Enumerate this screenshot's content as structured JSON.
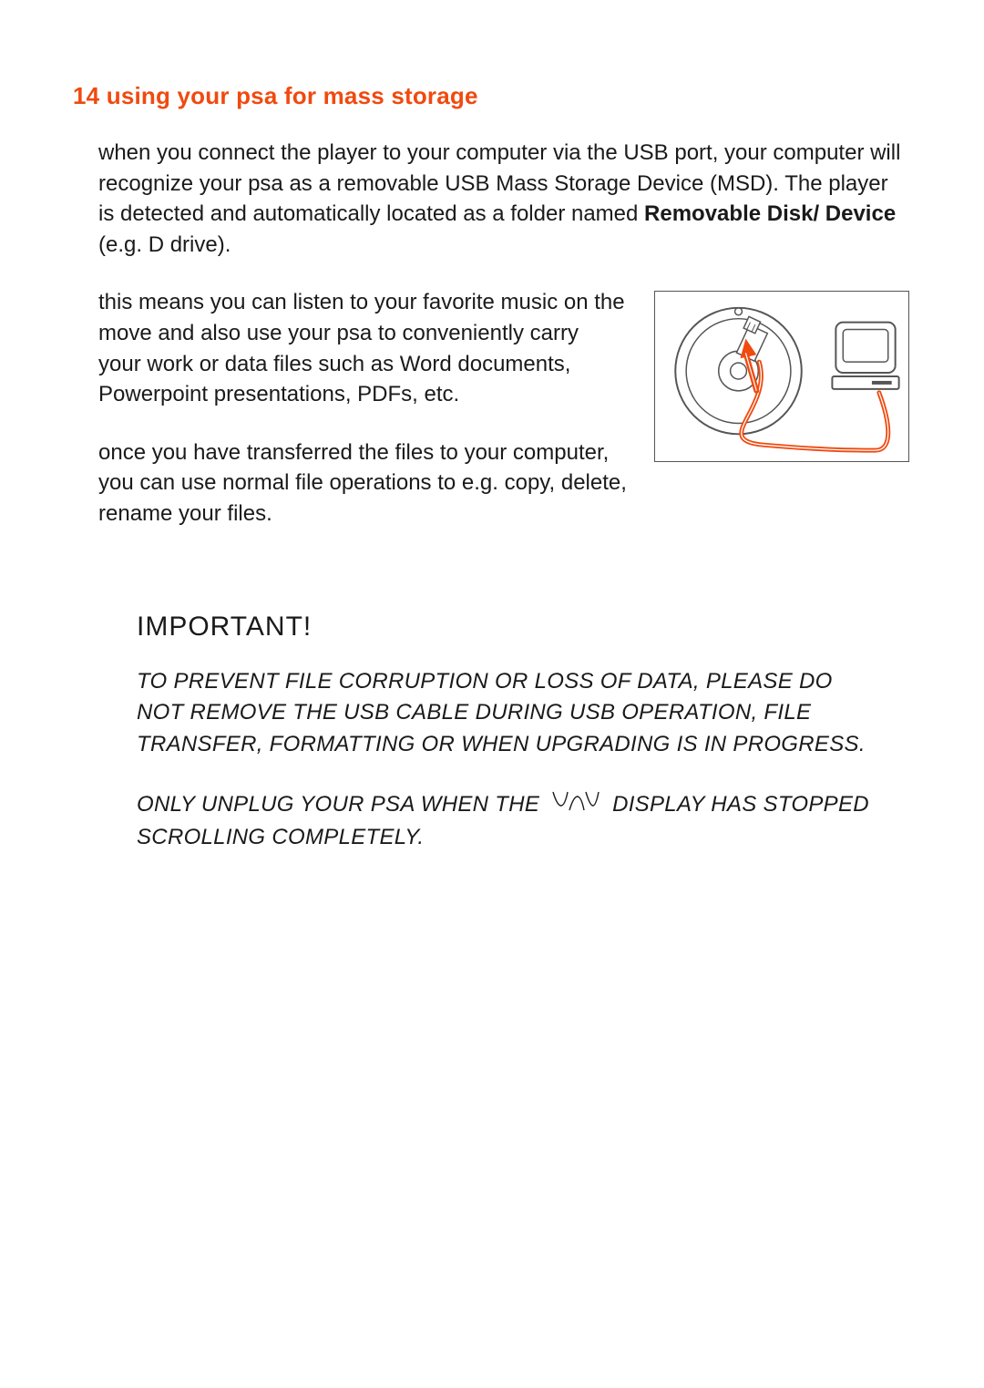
{
  "heading": {
    "number": "14",
    "title": "using your psa for mass storage"
  },
  "paragraphs": {
    "p1_before_bold": "when you connect the player to your computer via the USB port, your computer will recognize your psa as a removable USB Mass Storage Device (MSD).  The player is detected and automatically located as a folder named ",
    "p1_bold": "Removable Disk/ Device",
    "p1_after_bold": " (e.g. D drive).",
    "p2": "this means you can listen to your favorite music on the move and also use your psa to conveniently carry your work or data files such as Word documents, Powerpoint presentations, PDFs, etc.",
    "p3": "once you have transferred the files to your computer, you can use normal file operations to e.g. copy, delete, rename your files."
  },
  "important": {
    "title": "IMPORTANT!",
    "p1": "TO PREVENT FILE CORRUPTION OR LOSS OF DATA, PLEASE DO NOT REMOVE THE USB CABLE DURING USB OPERATION, FILE TRANSFER, FORMATTING OR WHEN UPGRADING IS IN PROGRESS.",
    "p2_before": "ONLY UNPLUG YOUR PSA WHEN THE ",
    "p2_after": " DISPLAY HAS STOPPED SCROLLING COMPLETELY."
  },
  "icons": {
    "wave": "wave-icon",
    "usb_fig": "usb-to-computer-illustration"
  }
}
